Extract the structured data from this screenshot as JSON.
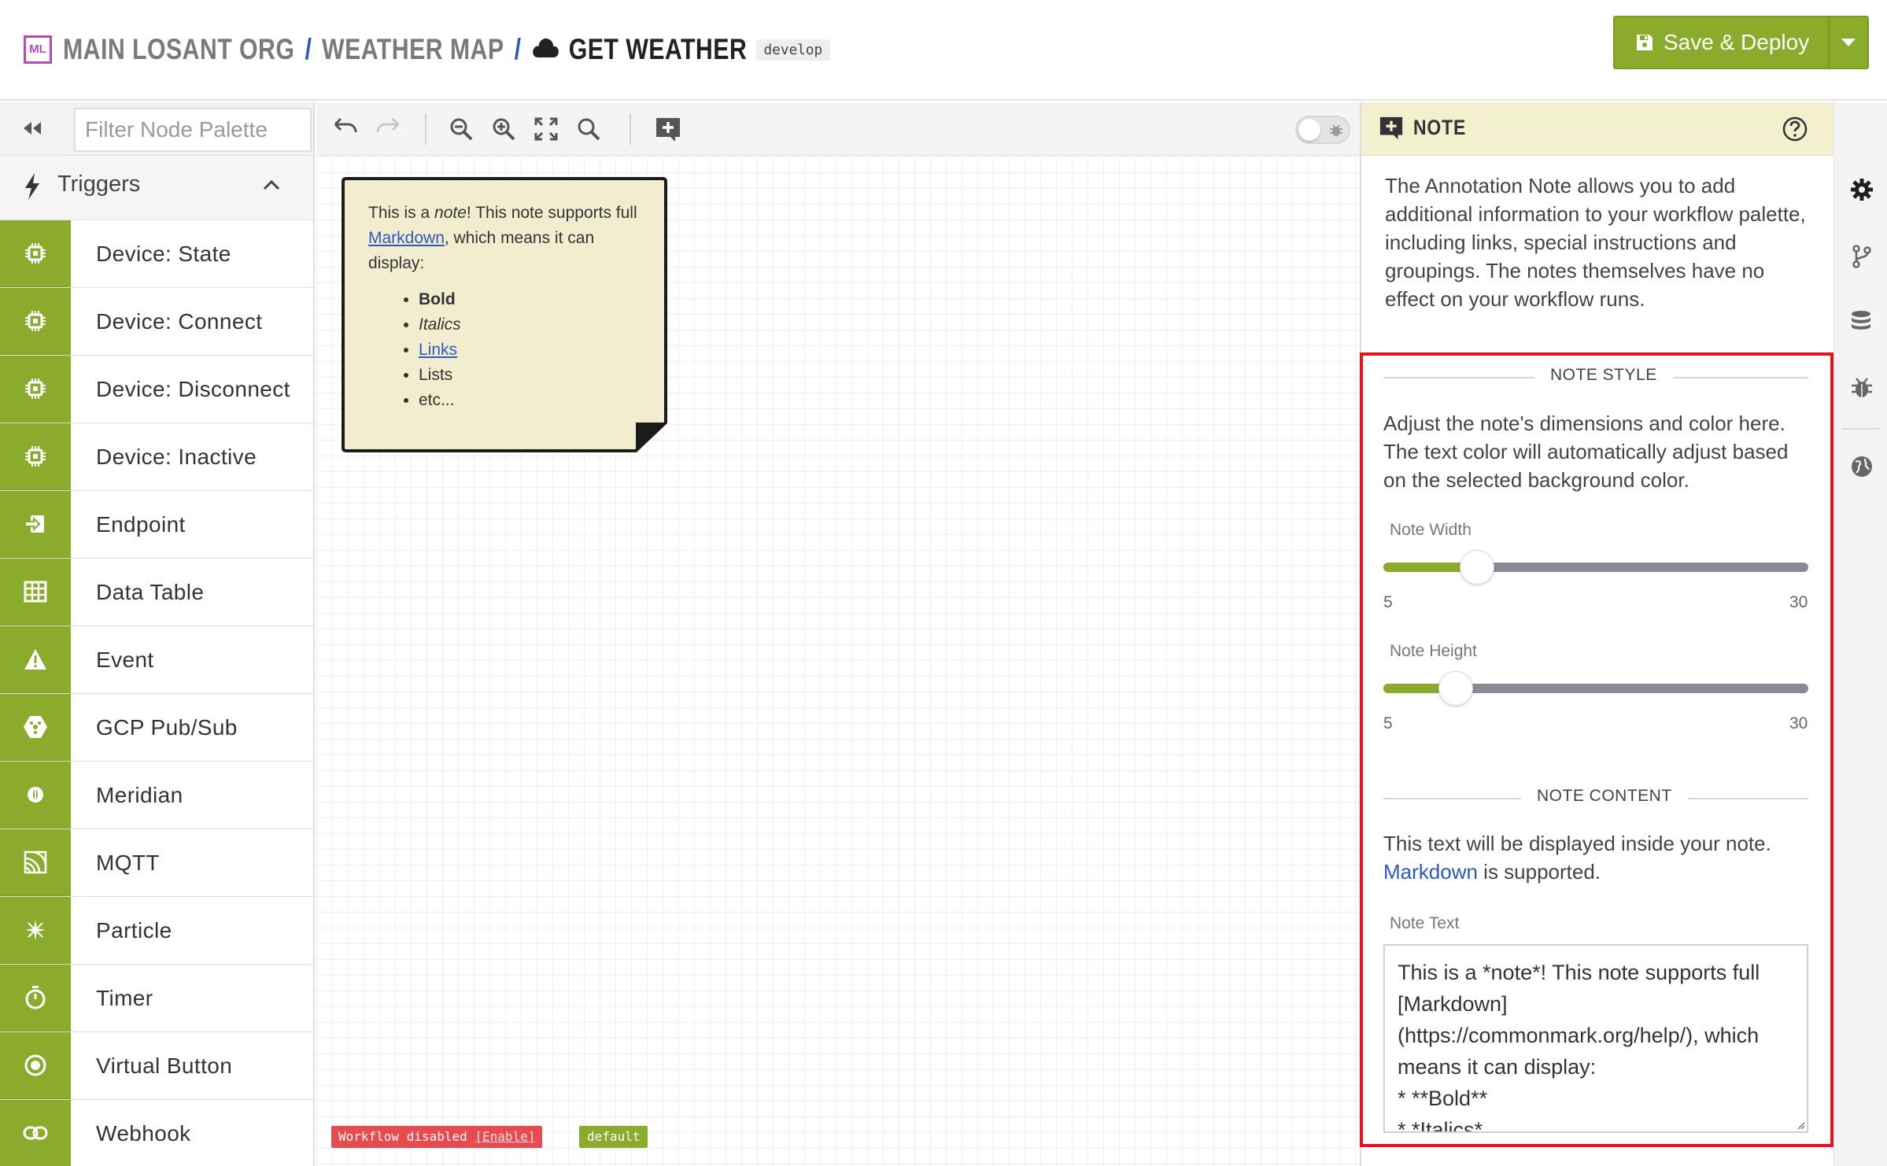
{
  "header": {
    "logo_text": "ML",
    "crumbs": [
      "MAIN LOSANT ORG",
      "WEATHER MAP",
      "GET WEATHER"
    ],
    "separator": "/",
    "branch": "develop",
    "deploy_label": "Save & Deploy"
  },
  "palette": {
    "filter_placeholder": "Filter Node Palette",
    "group_label": "Triggers",
    "nodes": [
      {
        "label": "Device: State",
        "icon": "chip-icon"
      },
      {
        "label": "Device: Connect",
        "icon": "chip-icon"
      },
      {
        "label": "Device: Disconnect",
        "icon": "chip-icon"
      },
      {
        "label": "Device: Inactive",
        "icon": "chip-icon"
      },
      {
        "label": "Endpoint",
        "icon": "endpoint-icon"
      },
      {
        "label": "Data Table",
        "icon": "table-icon"
      },
      {
        "label": "Event",
        "icon": "warning-icon"
      },
      {
        "label": "GCP Pub/Sub",
        "icon": "gcp-icon"
      },
      {
        "label": "Meridian",
        "icon": "meridian-icon"
      },
      {
        "label": "MQTT",
        "icon": "mqtt-icon"
      },
      {
        "label": "Particle",
        "icon": "particle-icon"
      },
      {
        "label": "Timer",
        "icon": "timer-icon"
      },
      {
        "label": "Virtual Button",
        "icon": "radio-button-icon"
      },
      {
        "label": "Webhook",
        "icon": "link-icon"
      }
    ]
  },
  "canvas": {
    "note": {
      "line1_pre": "This is a ",
      "line1_em": "note",
      "line1_post": "! This note supports full ",
      "link": "Markdown",
      "line1_end": ", which means it can display:",
      "item_bold": "Bold",
      "item_italic": "Italics",
      "item_link": "Links",
      "item_lists": "Lists",
      "item_etc": "etc..."
    },
    "status_badge_text": "Workflow disabled ",
    "status_badge_link": "[Enable]",
    "version_badge": "default"
  },
  "panel": {
    "title": "NOTE",
    "description": "The Annotation Note allows you to add additional information to your workflow palette, including links, special instructions and groupings. The notes themselves have no effect on your workflow runs.",
    "style_section": "NOTE STYLE",
    "style_text": "Adjust the note's dimensions and color here. The text color will automatically adjust based on the selected background color.",
    "width_label": "Note Width",
    "width_min": "5",
    "width_max": "30",
    "width_value_fraction": 0.22,
    "height_label": "Note Height",
    "height_min": "5",
    "height_max": "30",
    "height_value_fraction": 0.17,
    "content_section": "NOTE CONTENT",
    "content_text_pre": "This text will be displayed inside your note. ",
    "content_link": "Markdown",
    "content_text_post": " is supported.",
    "note_text_label": "Note Text",
    "note_text_value": "This is a *note*! This note supports full [Markdown](https://commonmark.org/help/), which means it can display:\n* **Bold**\n* *Italics*\n* [Links](https://losant.com)\n* Lists\n* etc..."
  },
  "colors": {
    "accent_green": "#8aab2c",
    "note_background": "#f3edcf",
    "highlight_border": "#e8131c",
    "link_blue": "#2b59c3",
    "logo_purple": "#b74ab7"
  }
}
